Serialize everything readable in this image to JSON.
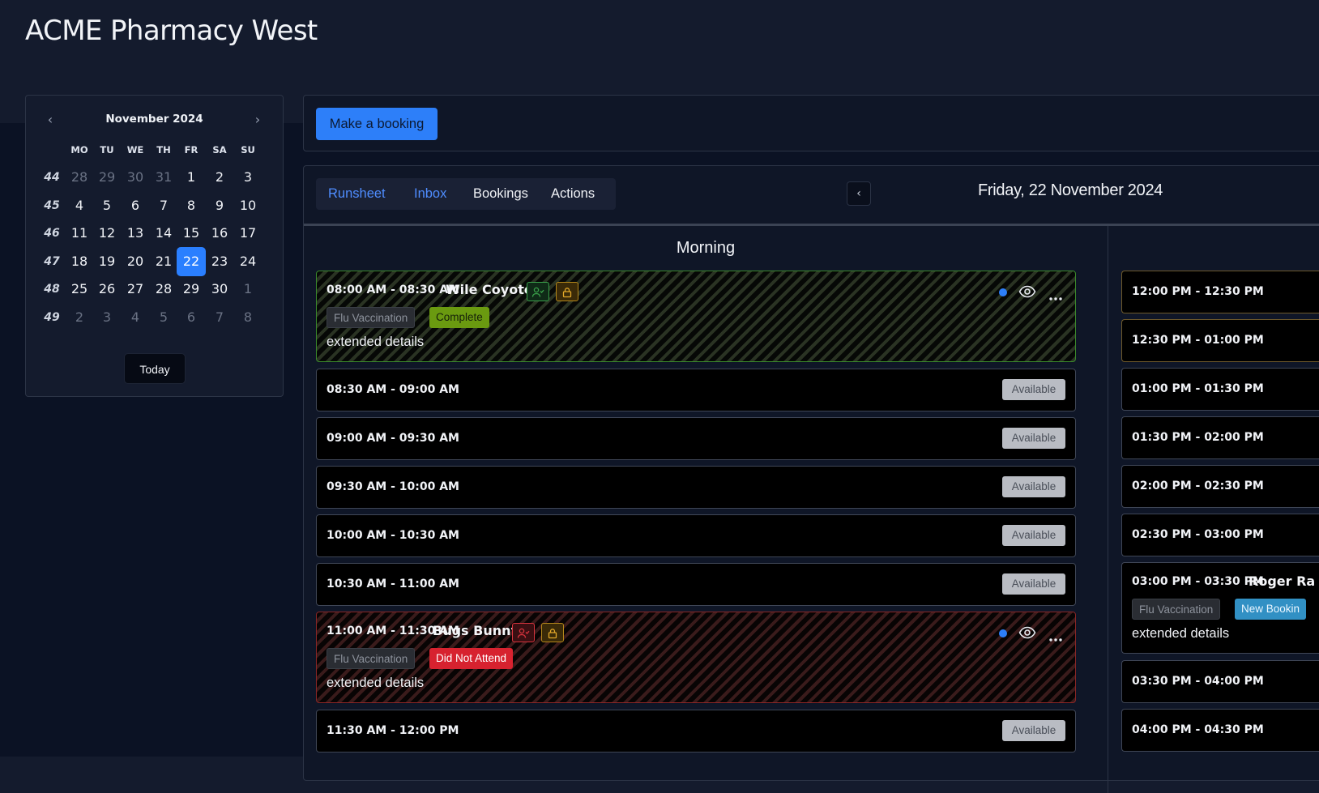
{
  "app": {
    "title": "ACME Pharmacy West"
  },
  "calendar": {
    "month_label": "November 2024",
    "prev_label": "‹",
    "next_label": "›",
    "dow": [
      "MO",
      "TU",
      "WE",
      "TH",
      "FR",
      "SA",
      "SU"
    ],
    "weeks": [
      {
        "num": "44",
        "days": [
          {
            "d": "28",
            "other": true
          },
          {
            "d": "29",
            "other": true
          },
          {
            "d": "30",
            "other": true
          },
          {
            "d": "31",
            "other": true
          },
          {
            "d": "1"
          },
          {
            "d": "2"
          },
          {
            "d": "3"
          }
        ]
      },
      {
        "num": "45",
        "days": [
          {
            "d": "4"
          },
          {
            "d": "5"
          },
          {
            "d": "6"
          },
          {
            "d": "7"
          },
          {
            "d": "8"
          },
          {
            "d": "9"
          },
          {
            "d": "10"
          }
        ]
      },
      {
        "num": "46",
        "days": [
          {
            "d": "11"
          },
          {
            "d": "12"
          },
          {
            "d": "13"
          },
          {
            "d": "14"
          },
          {
            "d": "15"
          },
          {
            "d": "16"
          },
          {
            "d": "17"
          }
        ]
      },
      {
        "num": "47",
        "days": [
          {
            "d": "18"
          },
          {
            "d": "19"
          },
          {
            "d": "20"
          },
          {
            "d": "21"
          },
          {
            "d": "22",
            "selected": true
          },
          {
            "d": "23"
          },
          {
            "d": "24"
          }
        ]
      },
      {
        "num": "48",
        "days": [
          {
            "d": "25"
          },
          {
            "d": "26"
          },
          {
            "d": "27"
          },
          {
            "d": "28"
          },
          {
            "d": "29"
          },
          {
            "d": "30"
          },
          {
            "d": "1",
            "other": true
          }
        ]
      },
      {
        "num": "49",
        "days": [
          {
            "d": "2",
            "other": true
          },
          {
            "d": "3",
            "other": true
          },
          {
            "d": "4",
            "other": true
          },
          {
            "d": "5",
            "other": true
          },
          {
            "d": "6",
            "other": true
          },
          {
            "d": "7",
            "other": true
          },
          {
            "d": "8",
            "other": true
          }
        ]
      }
    ],
    "today_label": "Today"
  },
  "toolbar": {
    "make_booking_label": "Make a booking"
  },
  "tabs": [
    {
      "label": "Runsheet",
      "active": true
    },
    {
      "label": "Inbox",
      "active": false
    },
    {
      "label": "Bookings",
      "active": false
    },
    {
      "label": "Actions",
      "active": false
    }
  ],
  "date_nav": {
    "prev_label": "‹",
    "current_date": "Friday, 22 November 2024"
  },
  "morning": {
    "heading": "Morning",
    "slots": [
      {
        "time": "08:00 AM - 08:30 AM",
        "name": "Wile Coyote",
        "service": "Flu Vaccination",
        "status": "Complete",
        "status_kind": "complete",
        "details": "extended details"
      },
      {
        "time": "08:30 AM - 09:00 AM",
        "availability": "Available"
      },
      {
        "time": "09:00 AM - 09:30 AM",
        "availability": "Available"
      },
      {
        "time": "09:30 AM - 10:00 AM",
        "availability": "Available"
      },
      {
        "time": "10:00 AM - 10:30 AM",
        "availability": "Available"
      },
      {
        "time": "10:30 AM - 11:00 AM",
        "availability": "Available"
      },
      {
        "time": "11:00 AM - 11:30 AM",
        "name": "Bugs Bunny",
        "service": "Flu Vaccination",
        "status": "Did Not Attend",
        "status_kind": "dna",
        "details": "extended details"
      },
      {
        "time": "11:30 AM - 12:00 PM",
        "availability": "Available"
      }
    ]
  },
  "afternoon": {
    "slots": [
      {
        "time": "12:00 PM - 12:30 PM"
      },
      {
        "time": "12:30 PM - 01:00 PM"
      },
      {
        "time": "01:00 PM - 01:30 PM"
      },
      {
        "time": "01:30 PM - 02:00 PM"
      },
      {
        "time": "02:00 PM - 02:30 PM"
      },
      {
        "time": "02:30 PM - 03:00 PM"
      },
      {
        "time": "03:00 PM - 03:30 PM",
        "name": "Roger Ra",
        "service": "Flu Vaccination",
        "status": "New Bookin",
        "details": "extended details"
      },
      {
        "time": "03:30 PM - 04:00 PM"
      },
      {
        "time": "04:00 PM - 04:30 PM"
      }
    ]
  },
  "colors": {
    "accent": "#2d7ff9",
    "complete": "#6a9a10",
    "did_not_attend": "#d7222f",
    "new_booking": "#3190c4"
  },
  "icons": [
    "chevron-left-icon",
    "chevron-right-icon",
    "person-icon",
    "lock-icon",
    "status-dot-icon",
    "eye-icon",
    "more-icon"
  ]
}
